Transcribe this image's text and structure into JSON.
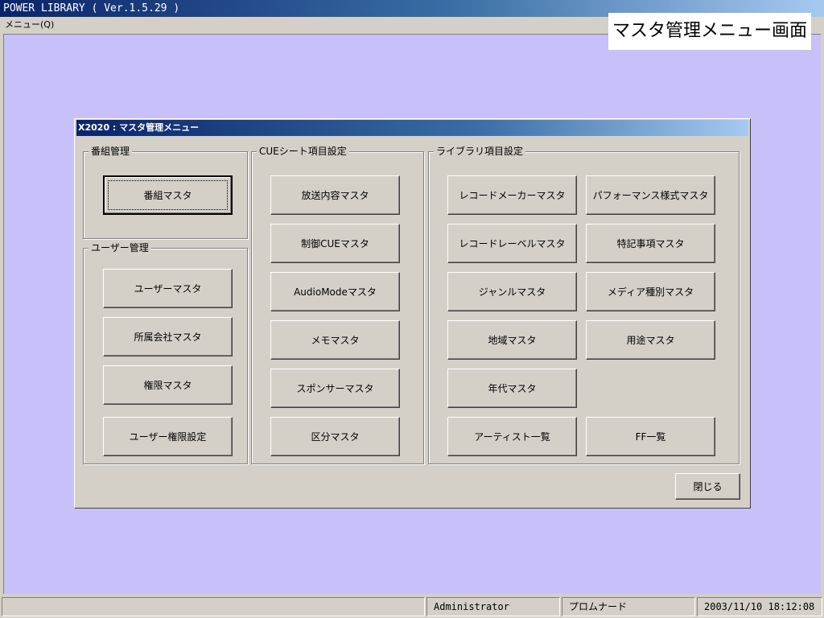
{
  "app": {
    "title": "POWER  LIBRARY ( Ver.1.5.29 )"
  },
  "menubar": {
    "menu_label": "メニュー(Q)"
  },
  "screen_label": "マスタ管理メニュー画面",
  "dialog": {
    "title": "X2020 : マスタ管理メニュー",
    "groups": {
      "program": {
        "label": "番組管理",
        "buttons": [
          "番組マスタ"
        ]
      },
      "user": {
        "label": "ユーザー管理",
        "buttons": [
          "ユーザーマスタ",
          "所属会社マスタ",
          "権限マスタ",
          "ユーザー権限設定"
        ]
      },
      "cue": {
        "label": "CUEシート項目設定",
        "buttons": [
          "放送内容マスタ",
          "制御CUEマスタ",
          "AudioModeマスタ",
          "メモマスタ",
          "スポンサーマスタ",
          "区分マスタ"
        ]
      },
      "library": {
        "label": "ライブラリ項目設定",
        "buttons": [
          "レコードメーカーマスタ",
          "パフォーマンス様式マスタ",
          "レコードレーベルマスタ",
          "特記事項マスタ",
          "ジャンルマスタ",
          "メディア種別マスタ",
          "地域マスタ",
          "用途マスタ",
          "年代マスタ",
          "アーティスト一覧",
          "FF一覧"
        ]
      }
    },
    "close_label": "閉じる"
  },
  "statusbar": {
    "user": "Administrator",
    "location": "プロムナード",
    "datetime": "2003/11/10 18:12:08"
  },
  "colors": {
    "title_bar_start": "#0a246a",
    "title_bar_end": "#a6caf0",
    "desktop_background": "#c8c0f8",
    "face": "#d4d0c8"
  }
}
